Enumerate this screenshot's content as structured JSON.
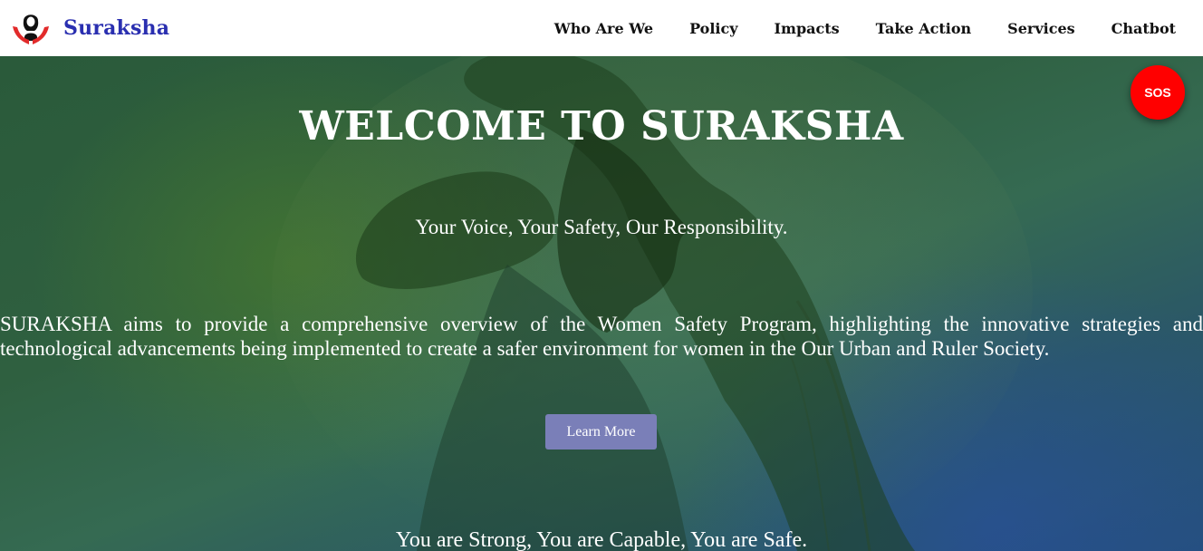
{
  "header": {
    "brand_name": "Suraksha",
    "logo_icon": "woman-hands-logo-icon",
    "nav": [
      {
        "label": "Who Are We"
      },
      {
        "label": "Policy"
      },
      {
        "label": "Impacts"
      },
      {
        "label": "Take Action"
      },
      {
        "label": "Services"
      },
      {
        "label": "Chatbot"
      }
    ]
  },
  "hero": {
    "title": "WELCOME TO SURAKSHA",
    "tagline": "Your Voice, Your Safety, Our Responsibility.",
    "description": "SURAKSHA aims to provide a comprehensive overview of the Women Safety Program, highlighting the innovative strategies and technological advancements being implemented to create a safer environment for women in the Our Urban and Ruler Society.",
    "button_label": "Learn More",
    "motto": "You are Strong, You are Capable, You are Safe.",
    "sos_label": "SOS"
  },
  "colors": {
    "brand": "#2a2fb0",
    "sos": "#ff0000",
    "button": "#7a7fb8"
  }
}
